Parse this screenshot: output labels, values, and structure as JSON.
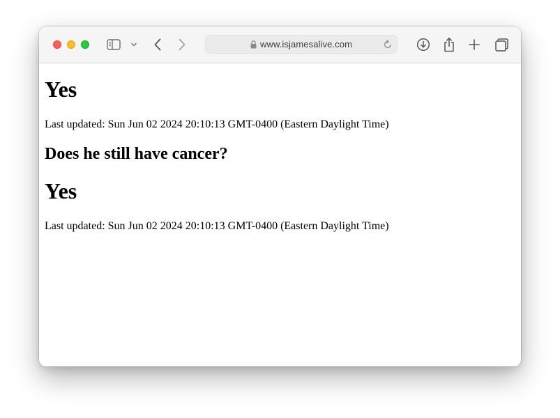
{
  "browser": {
    "url": "www.isjamesalive.com",
    "icons": {
      "close": "close-button",
      "minimize": "minimize-button",
      "maximize": "maximize-button",
      "sidebar": "sidebar-icon",
      "tab_overview_chevron": "chevron-down-icon",
      "back": "back-arrow-icon",
      "forward": "forward-arrow-icon",
      "lock": "lock-icon",
      "reload": "reload-icon",
      "downloads": "download-icon",
      "share": "share-icon",
      "new_tab": "plus-icon",
      "tabs": "tab-overview-icon"
    }
  },
  "page": {
    "answer_alive": "Yes",
    "updated_1": "Last updated: Sun Jun 02 2024 20:10:13 GMT-0400 (Eastern Daylight Time)",
    "question_cancer": "Does he still have cancer?",
    "answer_cancer": "Yes",
    "updated_2": "Last updated: Sun Jun 02 2024 20:10:13 GMT-0400 (Eastern Daylight Time)"
  }
}
